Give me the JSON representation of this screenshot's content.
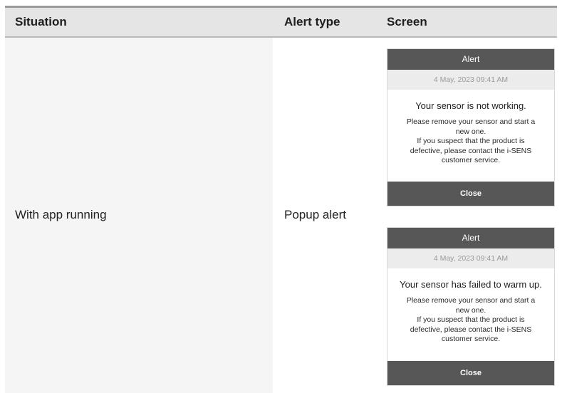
{
  "table": {
    "headers": {
      "situation": "Situation",
      "alert_type": "Alert type",
      "screen": "Screen"
    },
    "row": {
      "situation": "With app running",
      "alert_type": "Popup alert"
    }
  },
  "alerts": [
    {
      "title": "Alert",
      "date": "4 May, 2023  09:41 AM",
      "message": "Your sensor is not working.",
      "detail": "Please remove your sensor and start a\nnew one.\nIf you suspect that the product is\ndefective, please contact the i-SENS\ncustomer service.",
      "close_label": "Close"
    },
    {
      "title": "Alert",
      "date": "4 May, 2023  09:41 AM",
      "message": "Your sensor has failed to warm up.",
      "detail": "Please remove your sensor and start a\nnew one.\nIf you suspect that the product is\ndefective, please contact the i-SENS\ncustomer service.",
      "close_label": "Close"
    }
  ]
}
